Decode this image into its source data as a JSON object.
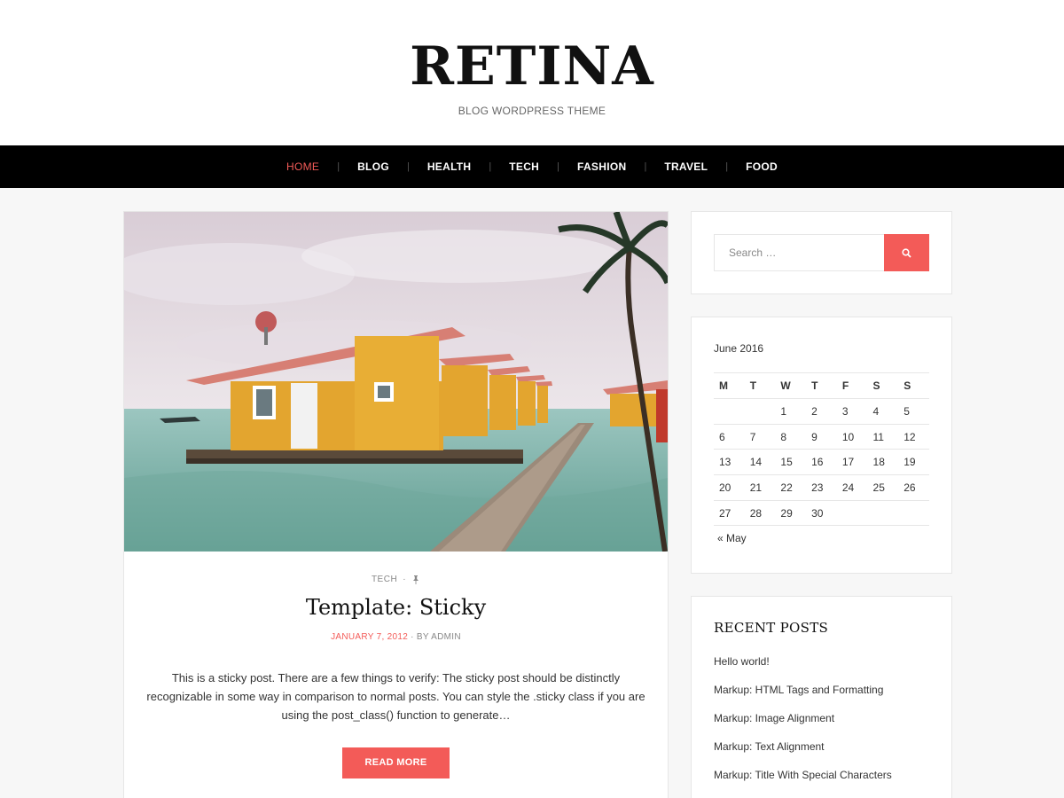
{
  "site": {
    "title": "RETINA",
    "tagline": "BLOG WORDPRESS THEME"
  },
  "nav": {
    "items": [
      {
        "label": "HOME",
        "active": true
      },
      {
        "label": "BLOG"
      },
      {
        "label": "HEALTH"
      },
      {
        "label": "TECH"
      },
      {
        "label": "FASHION"
      },
      {
        "label": "TRAVEL"
      },
      {
        "label": "FOOD"
      }
    ]
  },
  "post": {
    "category": "TECH",
    "title": "Template: Sticky",
    "date": "JANUARY 7, 2012",
    "author_prefix": "BY",
    "author": "ADMIN",
    "excerpt": "This is a sticky post. There are a few things to verify: The sticky post should be distinctly recognizable in some way in comparison to normal posts. You can style the .sticky class if you are using the post_class() function to generate…",
    "read_more_label": "READ MORE"
  },
  "search": {
    "placeholder": "Search …"
  },
  "calendar": {
    "caption": "June 2016",
    "weekdays": [
      "M",
      "T",
      "W",
      "T",
      "F",
      "S",
      "S"
    ],
    "weeks": [
      [
        "",
        "",
        "1",
        "2",
        "3",
        "4",
        "5"
      ],
      [
        "6",
        "7",
        "8",
        "9",
        "10",
        "11",
        "12"
      ],
      [
        "13",
        "14",
        "15",
        "16",
        "17",
        "18",
        "19"
      ],
      [
        "20",
        "21",
        "22",
        "23",
        "24",
        "25",
        "26"
      ],
      [
        "27",
        "28",
        "29",
        "30",
        "",
        "",
        ""
      ]
    ],
    "prev_label": "« May"
  },
  "recent_posts": {
    "title": "RECENT POSTS",
    "items": [
      "Hello world!",
      "Markup: HTML Tags and Formatting",
      "Markup: Image Alignment",
      "Markup: Text Alignment",
      "Markup: Title With Special Characters"
    ]
  },
  "colors": {
    "accent": "#f35b58",
    "nav_bg": "#000000",
    "page_bg": "#f7f7f7"
  }
}
